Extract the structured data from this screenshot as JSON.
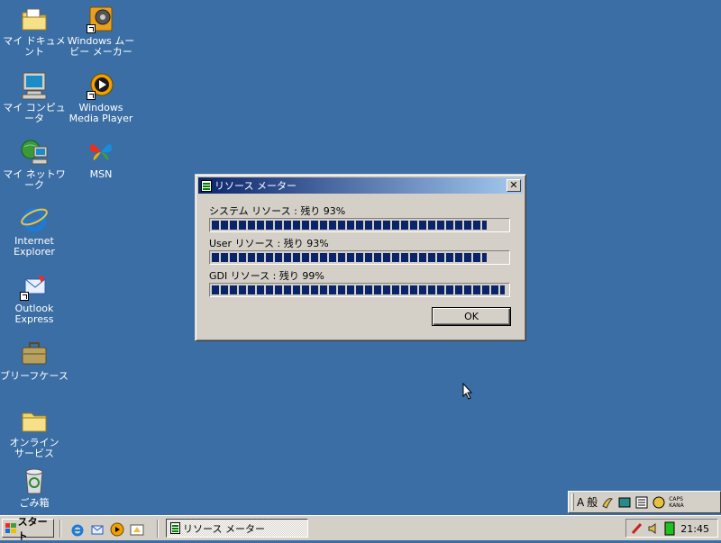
{
  "desktop": {
    "icons": [
      {
        "name": "my-documents",
        "label": "マイ ドキュメント"
      },
      {
        "name": "windows-movie-maker",
        "label": "Windows ムー\nビー メーカー"
      },
      {
        "name": "my-computer",
        "label": "マイ コンピュータ"
      },
      {
        "name": "windows-media-player",
        "label": "Windows\nMedia Player"
      },
      {
        "name": "my-network",
        "label": "マイ ネットワーク"
      },
      {
        "name": "msn",
        "label": "MSN"
      },
      {
        "name": "internet-explorer",
        "label": "Internet\nExplorer"
      },
      {
        "name": "outlook-express",
        "label": "Outlook\nExpress"
      },
      {
        "name": "briefcase",
        "label": "ブリーフケース"
      },
      {
        "name": "online-services",
        "label": "オンライン\nサービス"
      },
      {
        "name": "recycle-bin",
        "label": "ごみ箱"
      }
    ]
  },
  "dialog": {
    "title": "リソース メーター",
    "close_symbol": "✕",
    "meters": [
      {
        "label": "システム リソース : 残り 93%",
        "percent": 93
      },
      {
        "label": "User リソース : 残り 93%",
        "percent": 93
      },
      {
        "label": "GDI リソース : 残り 99%",
        "percent": 99
      }
    ],
    "ok_label": "OK"
  },
  "taskbar": {
    "start_label": "スタート",
    "task_label": "リソース メーター",
    "clock": "21:45"
  },
  "ime": {
    "mode": "A",
    "style": "般",
    "caps": "CAPS",
    "kana": "KANA"
  },
  "colors": {
    "desktop": "#3a6ea5",
    "title_active": "#0a246a",
    "meter_fill": "#0a246a"
  }
}
